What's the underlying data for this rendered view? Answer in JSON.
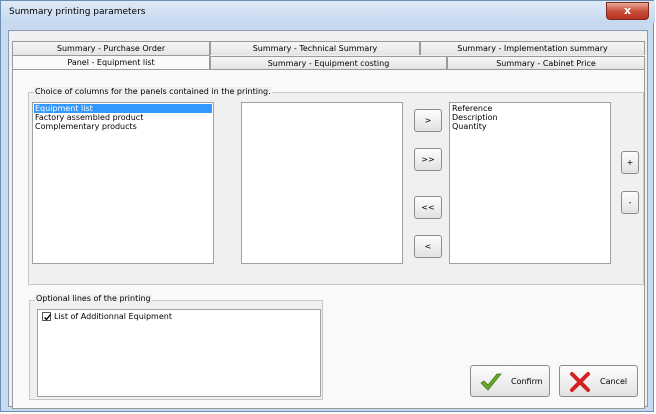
{
  "window": {
    "title": "Summary printing parameters",
    "close_glyph": "x"
  },
  "tabs": {
    "row1": [
      "Summary - Purchase Order",
      "Summary - Technical Summary",
      "Summary - Implementation summary"
    ],
    "row2": [
      "Panel - Equipment list",
      "Summary - Equipment costing",
      "Summary - Cabinet Price"
    ],
    "active": "Panel - Equipment list"
  },
  "columns_group": {
    "label": "Choice of columns for the panels contained in the printing.",
    "source_list": [
      {
        "label": "Equipment list",
        "selected": true
      },
      {
        "label": "Factory assembled product",
        "selected": false
      },
      {
        "label": "Complementary products",
        "selected": false
      }
    ],
    "available_list": [],
    "chosen_list": [
      {
        "label": "Reference"
      },
      {
        "label": "Description"
      },
      {
        "label": "Quantity"
      }
    ],
    "buttons": {
      "add_one": ">",
      "add_all": ">>",
      "remove_all": "<<",
      "remove_one": "<",
      "move_up": "+",
      "move_down": "-"
    }
  },
  "optional_group": {
    "label": "Optional lines of the printing",
    "items": [
      {
        "label": "List of Additionnal Equipment",
        "checked": true
      }
    ]
  },
  "actions": {
    "confirm": "Confirm",
    "cancel": "Cancel"
  },
  "colors": {
    "selection": "#3399ff",
    "confirm_check": "#6aaa2a",
    "cancel_x": "#d42020"
  }
}
